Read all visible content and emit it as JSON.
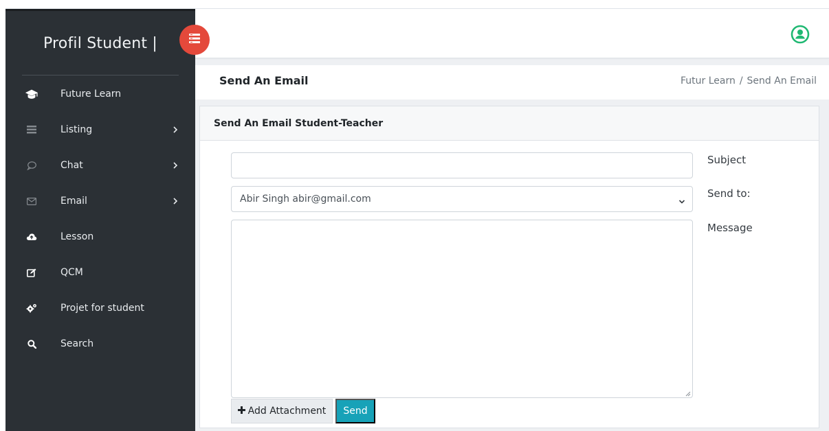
{
  "sidebar": {
    "brand": "Profil Student |",
    "items": [
      {
        "label": "Future Learn",
        "icon": "graduation-cap-icon",
        "chevron": false
      },
      {
        "label": "Listing",
        "icon": "list-icon",
        "chevron": true
      },
      {
        "label": "Chat",
        "icon": "chat-bubble-icon",
        "chevron": true
      },
      {
        "label": "Email",
        "icon": "envelope-icon",
        "chevron": true
      },
      {
        "label": "Lesson",
        "icon": "cloud-upload-icon",
        "chevron": false
      },
      {
        "label": "QCM",
        "icon": "edit-icon",
        "chevron": false
      },
      {
        "label": "Projet for student",
        "icon": "gears-icon",
        "chevron": false
      },
      {
        "label": "Search",
        "icon": "search-icon",
        "chevron": false
      }
    ]
  },
  "header": {
    "page_title": "Send An Email",
    "breadcrumb": [
      "Futur Learn",
      "/",
      "Send An Email"
    ]
  },
  "form": {
    "card_title": "Send An Email Student-Teacher",
    "subject_value": "",
    "subject_label": "Subject",
    "sendto_value": "Abir Singh abir@gmail.com",
    "sendto_label": "Send to:",
    "message_value": "",
    "message_label": "Message",
    "attach_label": "Add Attachment",
    "send_label": "Send"
  },
  "colors": {
    "sidebar_bg": "#2b3035",
    "toggle_accent": "#e4493b",
    "user_icon": "#1fb872",
    "send_button": "#17a2b8"
  }
}
